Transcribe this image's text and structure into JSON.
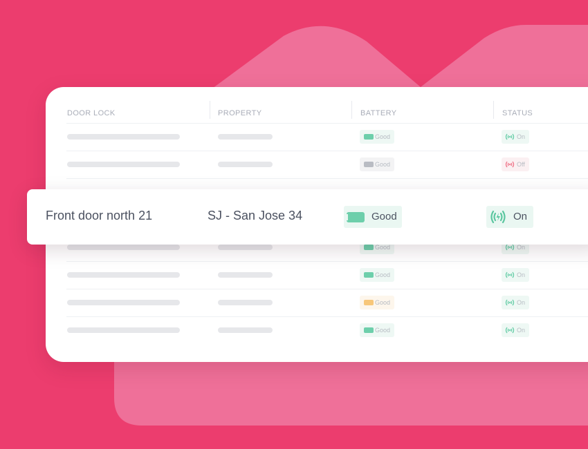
{
  "table": {
    "headers": [
      "DOOR LOCK",
      "PROPERTY",
      "BATTERY",
      "STATUS"
    ],
    "rows": [
      {
        "battery": "Good",
        "battery_state": "good",
        "status": "On",
        "status_state": "on"
      },
      {
        "battery": "Good",
        "battery_state": "unknown",
        "status": "Off",
        "status_state": "off"
      },
      {
        "battery": "Good",
        "battery_state": "good",
        "status": "On",
        "status_state": "on"
      },
      {
        "battery": "Good",
        "battery_state": "good",
        "status": "On",
        "status_state": "on"
      },
      {
        "battery": "Good",
        "battery_state": "warning",
        "status": "On",
        "status_state": "on"
      },
      {
        "battery": "Good",
        "battery_state": "good",
        "status": "On",
        "status_state": "on"
      }
    ]
  },
  "highlight": {
    "door_lock": "Front door north 21",
    "property": "SJ - San Jose 34",
    "battery": "Good",
    "status": "On"
  },
  "colors": {
    "background": "#ec3d6e",
    "backdrop": "#ef7099",
    "good": "#6dcfab",
    "warning": "#f7c77a",
    "off": "#ef7a8e",
    "unknown": "#b9bcc3"
  },
  "icons": {
    "battery": "battery-icon",
    "status": "wireless-signal-icon"
  }
}
